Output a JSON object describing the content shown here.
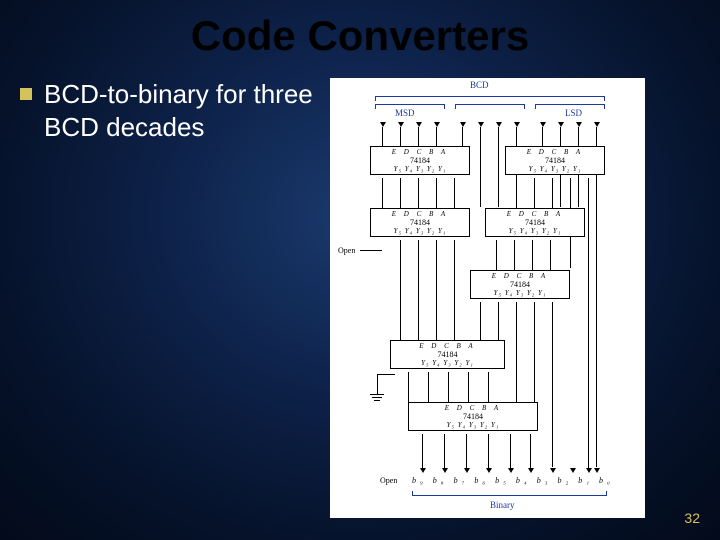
{
  "title": "Code Converters",
  "bullet_text": "BCD-to-binary for three BCD decades",
  "page_number": "32",
  "diagram": {
    "top_label": "BCD",
    "bottom_label": "Binary",
    "msd": "MSD",
    "lsd": "LSD",
    "open": "Open",
    "open2": "Open",
    "chip": "74184",
    "inputs": "E  D  C  B  A",
    "outputs": "Y₅ Y₄ Y₃ Y₂ Y₁",
    "binary_bits": "b₉  b₈  b₇  b₆  b₅  b₄  b₃  b₂  b₁  b₀"
  }
}
